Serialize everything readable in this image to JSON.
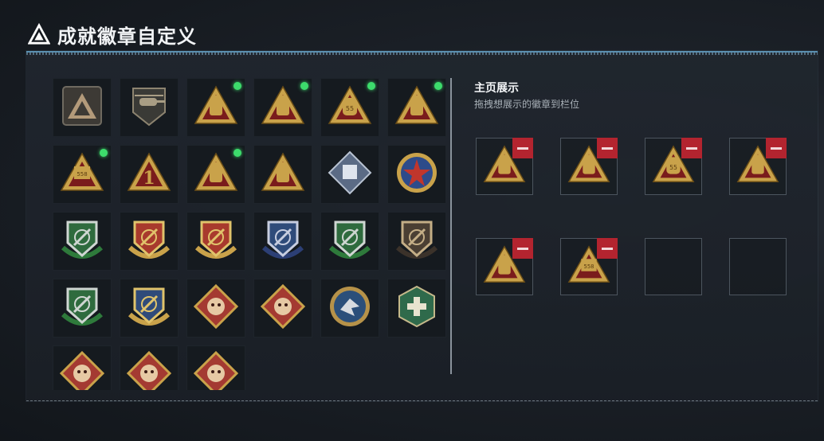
{
  "header": {
    "title": "成就徽章自定义",
    "icon": "triangle-emblem-icon"
  },
  "badges": [
    {
      "icon": "gray-triangle-badge-icon",
      "new": false
    },
    {
      "icon": "helicopter-badge-icon",
      "new": false
    },
    {
      "icon": "golden-triangle-helmet-badge-icon",
      "new": true
    },
    {
      "icon": "golden-triangle-crate-badge-icon",
      "new": true
    },
    {
      "icon": "golden-triangle-bag-55-badge-icon",
      "new": true
    },
    {
      "icon": "golden-triangle-supply-badge-icon",
      "new": true
    },
    {
      "icon": "golden-triangle-558-badge-icon",
      "new": true
    },
    {
      "icon": "golden-triangle-number-one-badge-icon",
      "new": false
    },
    {
      "icon": "golden-triangle-backpack-badge-icon",
      "new": true
    },
    {
      "icon": "golden-triangle-wolf-badge-icon",
      "new": false
    },
    {
      "icon": "silver-diamond-cube-badge-icon",
      "new": false
    },
    {
      "icon": "red-star-round-badge-icon",
      "new": false
    },
    {
      "icon": "green-shield-badge-icon",
      "new": false
    },
    {
      "icon": "red-gold-shield-badge-icon",
      "new": false
    },
    {
      "icon": "red-gold-shield-badge-2-icon",
      "new": false
    },
    {
      "icon": "blue-crosshair-shield-badge-icon",
      "new": false
    },
    {
      "icon": "green-crosshair-shield-badge-icon",
      "new": false
    },
    {
      "icon": "bronze-rifle-shield-badge-icon",
      "new": false
    },
    {
      "icon": "green-crosshair-wreath-badge-icon",
      "new": false
    },
    {
      "icon": "gold-crosshair-shield-badge-icon",
      "new": false
    },
    {
      "icon": "red-diamond-wolf-badge-icon",
      "new": false
    },
    {
      "icon": "red-diamond-wolf-badge-2-icon",
      "new": false
    },
    {
      "icon": "blue-round-eagle-badge-icon",
      "new": false
    },
    {
      "icon": "green-hexagon-medic-badge-icon",
      "new": false
    },
    {
      "icon": "red-diamond-dragon-badge-icon",
      "new": false
    },
    {
      "icon": "red-diamond-dragon-badge-2-icon",
      "new": false
    },
    {
      "icon": "red-diamond-fist-badge-icon",
      "new": false
    }
  ],
  "showcase": {
    "title": "主页展示",
    "subtitle": "拖拽想展示的徽章到栏位",
    "remove_icon": "remove-minus-icon",
    "slots": [
      {
        "icon": "golden-triangle-backpack-badge-icon",
        "filled": true
      },
      {
        "icon": "golden-triangle-supply-badge-icon",
        "filled": true
      },
      {
        "icon": "golden-triangle-bag-55-badge-icon",
        "filled": true
      },
      {
        "icon": "golden-triangle-crate-badge-icon",
        "filled": true
      },
      {
        "icon": "golden-triangle-helmet-badge-icon",
        "filled": true
      },
      {
        "icon": "golden-triangle-558-badge-icon",
        "filled": true
      },
      {
        "icon": "empty-slot",
        "filled": false
      },
      {
        "icon": "empty-slot",
        "filled": false
      }
    ]
  },
  "colors": {
    "gold": "#c9a24a",
    "dark_red": "#7a1c1c",
    "new_dot": "#3ddc6c",
    "remove_red": "#b3242f",
    "accent_blue": "#5a8fb0"
  }
}
